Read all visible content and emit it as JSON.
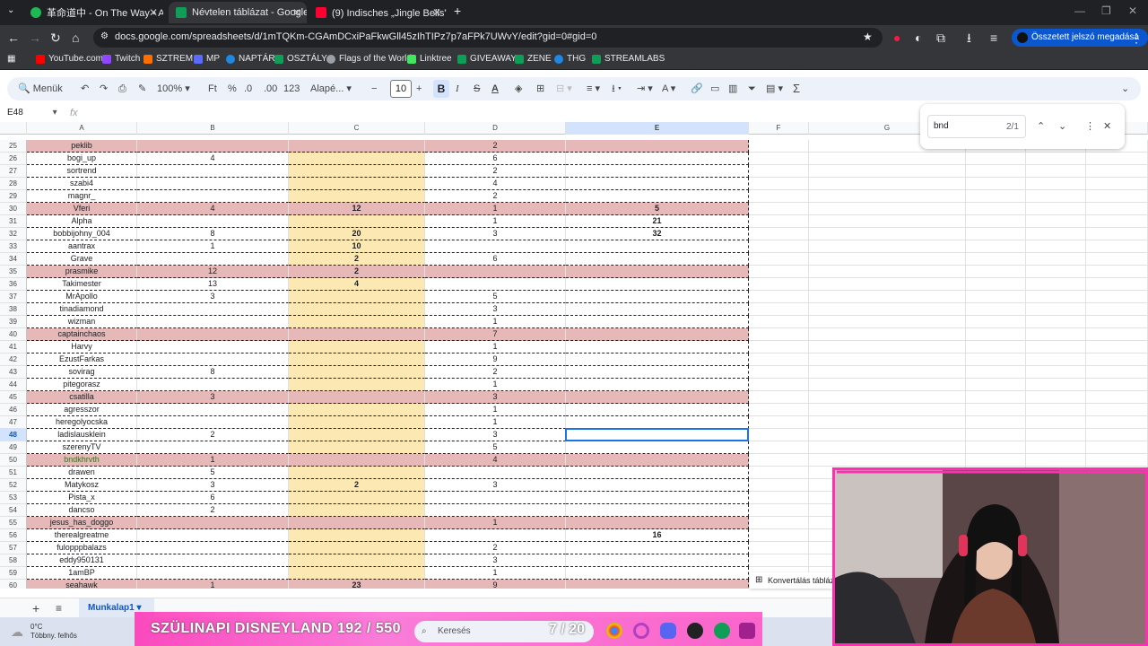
{
  "browser": {
    "tabs": [
      {
        "label": "革命道中 - On The Way • A",
        "color": "#1db954"
      },
      {
        "label": "Névtelen táblázat - Google Tábl",
        "color": "#0f9d58"
      },
      {
        "label": "(9) Indisches „Jingle Bells\" 😂",
        "color": "#ff0033"
      }
    ],
    "url": "docs.google.com/spreadsheets/d/1mTQKm-CGAmDCxiPaFkwGll45zIhTIPz7p7aFPk7UWvY/edit?gid=0#gid=0",
    "password_button": "Összetett jelszó megadása",
    "bookmarks": [
      {
        "label": "YouTube.com",
        "color": "#ff0000"
      },
      {
        "label": "Twitch",
        "color": "#9146ff"
      },
      {
        "label": "SZTREM",
        "color": "#ff6f00"
      },
      {
        "label": "MP",
        "color": "#5b6bff"
      },
      {
        "label": "NAPTÁR",
        "color": "#1e88e5"
      },
      {
        "label": "OSZTÁLY",
        "color": "#0f9d58"
      },
      {
        "label": "Flags of the World",
        "color": "#9aa0a6"
      },
      {
        "label": "Linktree",
        "color": "#43e660"
      },
      {
        "label": "GIVEAWAY",
        "color": "#0f9d58"
      },
      {
        "label": "ZENE",
        "color": "#0f9d58"
      },
      {
        "label": "THG",
        "color": "#1e88e5"
      },
      {
        "label": "STREAMLABS",
        "color": "#0f9d58"
      }
    ]
  },
  "toolbar": {
    "menus": "Menük",
    "zoom": "100%",
    "currency": "Ft",
    "percent": "%",
    "dec_less": ".0",
    "dec_more": ".00",
    "format123": "123",
    "font": "Alapé...",
    "font_size": "10",
    "bold": "B",
    "italic": "I",
    "sum": "Σ"
  },
  "formula": {
    "cell_ref": "E48",
    "fx": "fx"
  },
  "find": {
    "query": "bnd",
    "count": "2/1"
  },
  "columns": [
    {
      "label": "A",
      "selected": false
    },
    {
      "label": "B",
      "selected": false
    },
    {
      "label": "C",
      "selected": false
    },
    {
      "label": "D",
      "selected": false
    },
    {
      "label": "E",
      "selected": true
    },
    {
      "label": "F",
      "selected": false
    },
    {
      "label": "G",
      "selected": false
    }
  ],
  "rows": [
    {
      "n": "25",
      "pink": true,
      "a": "peklib",
      "b": "",
      "c": "",
      "d": "2",
      "e": ""
    },
    {
      "n": "26",
      "pink": false,
      "a": "bogi_up",
      "b": "4",
      "c": "",
      "d": "6",
      "e": ""
    },
    {
      "n": "27",
      "pink": false,
      "a": "sortrend",
      "b": "",
      "c": "",
      "d": "2",
      "e": ""
    },
    {
      "n": "28",
      "pink": false,
      "a": "szabi4",
      "b": "",
      "c": "",
      "d": "4",
      "e": ""
    },
    {
      "n": "29",
      "pink": false,
      "a": "magnr_",
      "b": "",
      "c": "",
      "d": "2",
      "e": ""
    },
    {
      "n": "30",
      "pink": true,
      "a": "Vferi",
      "b": "4",
      "c": "12",
      "d": "1",
      "e": "5"
    },
    {
      "n": "31",
      "pink": false,
      "a": "Alpha",
      "b": "",
      "c": "",
      "d": "1",
      "e": "21"
    },
    {
      "n": "32",
      "pink": false,
      "a": "bobbijohny_004",
      "b": "8",
      "c": "20",
      "d": "3",
      "e": "32"
    },
    {
      "n": "33",
      "pink": false,
      "a": "aantrax",
      "b": "1",
      "c": "10",
      "d": "",
      "e": ""
    },
    {
      "n": "34",
      "pink": false,
      "a": "Grave",
      "b": "",
      "c": "2",
      "d": "6",
      "e": ""
    },
    {
      "n": "35",
      "pink": true,
      "a": "prasmike",
      "b": "12",
      "c": "2",
      "d": "",
      "e": ""
    },
    {
      "n": "36",
      "pink": false,
      "a": "Takimester",
      "b": "13",
      "c": "4",
      "d": "",
      "e": ""
    },
    {
      "n": "37",
      "pink": false,
      "a": "MrApollo",
      "b": "3",
      "c": "",
      "d": "5",
      "e": ""
    },
    {
      "n": "38",
      "pink": false,
      "a": "tinadiamond",
      "b": "",
      "c": "",
      "d": "3",
      "e": ""
    },
    {
      "n": "39",
      "pink": false,
      "a": "wizman",
      "b": "",
      "c": "",
      "d": "1",
      "e": ""
    },
    {
      "n": "40",
      "pink": true,
      "a": "captainchaos",
      "b": "",
      "c": "",
      "d": "7",
      "e": ""
    },
    {
      "n": "41",
      "pink": false,
      "a": "Harvy",
      "b": "",
      "c": "",
      "d": "1",
      "e": ""
    },
    {
      "n": "42",
      "pink": false,
      "a": "EzustFarkas",
      "b": "",
      "c": "",
      "d": "9",
      "e": ""
    },
    {
      "n": "43",
      "pink": false,
      "a": "sovirag",
      "b": "8",
      "c": "",
      "d": "2",
      "e": ""
    },
    {
      "n": "44",
      "pink": false,
      "a": "pitegorasz",
      "b": "",
      "c": "",
      "d": "1",
      "e": ""
    },
    {
      "n": "45",
      "pink": true,
      "a": "csatilla",
      "b": "3",
      "c": "",
      "d": "3",
      "e": ""
    },
    {
      "n": "46",
      "pink": false,
      "a": "agresszor",
      "b": "",
      "c": "",
      "d": "1",
      "e": ""
    },
    {
      "n": "47",
      "pink": false,
      "a": "heregolyocska",
      "b": "",
      "c": "",
      "d": "1",
      "e": ""
    },
    {
      "n": "48",
      "pink": false,
      "a": "ladislausklein",
      "b": "2",
      "c": "",
      "d": "3",
      "e": "",
      "selected": true
    },
    {
      "n": "49",
      "pink": false,
      "a": "szerenyTV",
      "b": "",
      "c": "",
      "d": "5",
      "e": ""
    },
    {
      "n": "50",
      "pink": true,
      "a": "bndkhrvth",
      "b": "1",
      "c": "",
      "d": "4",
      "e": "",
      "match": true
    },
    {
      "n": "51",
      "pink": false,
      "a": "drawen",
      "b": "5",
      "c": "",
      "d": "",
      "e": ""
    },
    {
      "n": "52",
      "pink": false,
      "a": "Matykosz",
      "b": "3",
      "c": "2",
      "d": "3",
      "e": ""
    },
    {
      "n": "53",
      "pink": false,
      "a": "Pista_x",
      "b": "6",
      "c": "",
      "d": "",
      "e": ""
    },
    {
      "n": "54",
      "pink": false,
      "a": "dancso",
      "b": "2",
      "c": "",
      "d": "",
      "e": ""
    },
    {
      "n": "55",
      "pink": true,
      "a": "jesus_has_doggo",
      "b": "",
      "c": "",
      "d": "1",
      "e": ""
    },
    {
      "n": "56",
      "pink": false,
      "a": "therealgreatme",
      "b": "",
      "c": "",
      "d": "",
      "e": "16"
    },
    {
      "n": "57",
      "pink": false,
      "a": "fulopppbalazs",
      "b": "",
      "c": "",
      "d": "2",
      "e": ""
    },
    {
      "n": "58",
      "pink": false,
      "a": "eddy950131",
      "b": "",
      "c": "",
      "d": "3",
      "e": ""
    },
    {
      "n": "59",
      "pink": false,
      "a": "1amBP",
      "b": "",
      "c": "",
      "d": "1",
      "e": ""
    },
    {
      "n": "60",
      "pink": true,
      "a": "seahawk",
      "b": "1",
      "c": "23",
      "d": "9",
      "e": ""
    }
  ],
  "convert_banner": "Konvertálás táblázatba",
  "sheet_tab": "Munkalap1",
  "taskbar": {
    "weather_temp": "0°C",
    "weather_desc": "Többny. felhős",
    "search": "Keresés",
    "stream_title": "SZÜLINAPI DISNEYLAND 192 / 550",
    "stream_counter": "7 / 20"
  },
  "colors": {
    "pink_row": "#e6b8b7",
    "yellow_col": "#fce8b2",
    "match_cell": "#b6d7a8",
    "selection": "#1a73e8",
    "overlay_pink": "#ff2fb4"
  }
}
